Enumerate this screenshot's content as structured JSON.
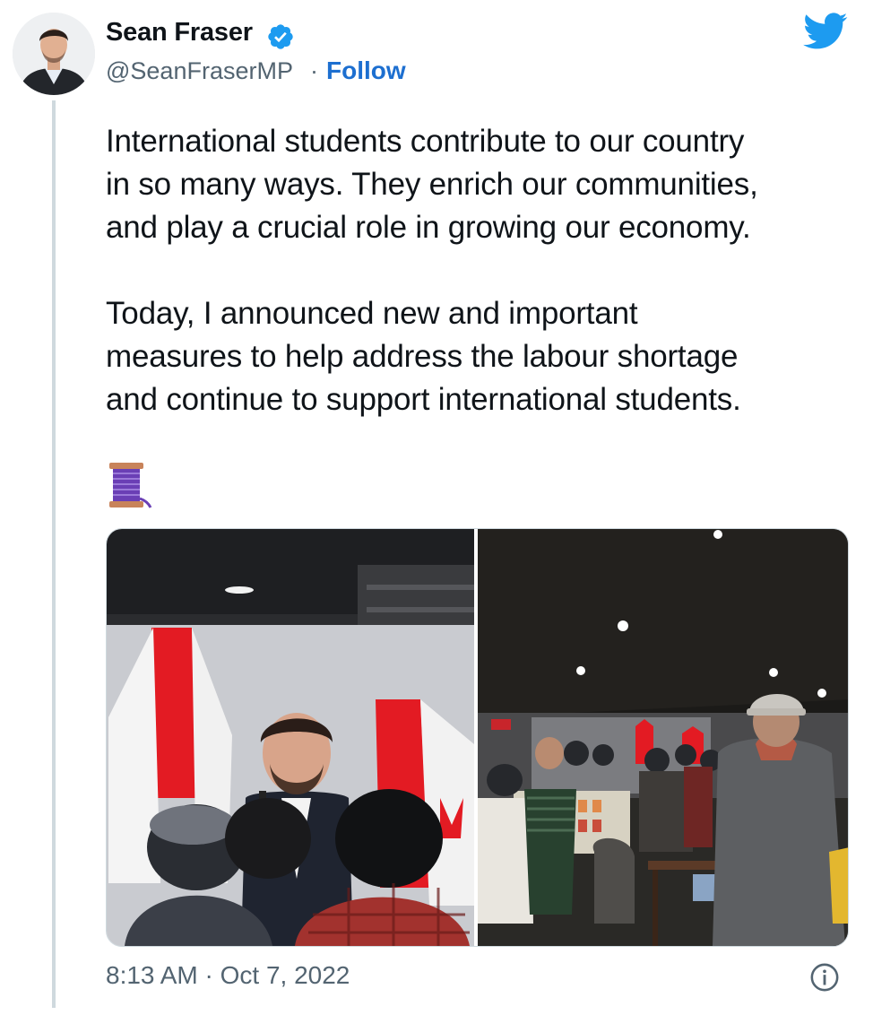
{
  "tweet": {
    "author_name": "Sean Fraser",
    "handle": "@SeanFraserMP",
    "separator": "·",
    "follow_label": "Follow",
    "paragraphs": [
      [
        "International students contribute to our country",
        "in so many ways. They enrich our communities,",
        "and play a crucial role in growing our economy."
      ],
      [
        "Today, I announced new and important",
        "measures to help address the labour shortage",
        "and continue to support international students."
      ]
    ],
    "thread_emoji": "spool-of-thread-icon",
    "timestamp": "8:13 AM · Oct 7, 2022"
  },
  "icons": {
    "verified": "verified-badge-icon",
    "brand": "twitter-bird-icon",
    "info": "info-icon"
  },
  "colors": {
    "link": "#1d6fd0",
    "verified": "#1d9bf0",
    "twitter": "#1d9bf0",
    "secondary_text": "#536471",
    "thread_line": "#cfd9de"
  }
}
